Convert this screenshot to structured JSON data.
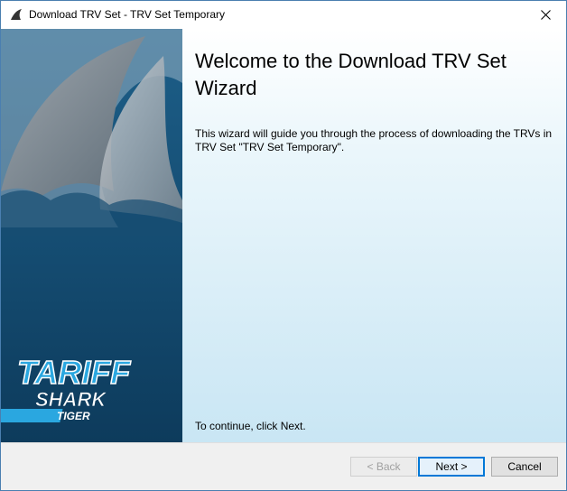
{
  "window": {
    "title": "Download TRV Set - TRV Set Temporary",
    "app_icon": "shark-fin-icon",
    "close_icon": "close-icon"
  },
  "banner": {
    "logo_lines": [
      "TARIFF",
      "SHARK",
      "TIGER"
    ]
  },
  "content": {
    "title": "Welcome to the Download TRV Set Wizard",
    "description": "This wizard will guide you through the process of downloading the TRVs in TRV Set \"TRV Set Temporary\".",
    "continue_text": "To continue, click Next."
  },
  "buttons": {
    "back_label": "< Back",
    "next_label": "Next >",
    "cancel_label": "Cancel"
  },
  "colors": {
    "banner_dark": "#0d3b5c",
    "banner_mid": "#1d5f89",
    "logo_blue": "#2aa7e0",
    "accent": "#0078d7"
  }
}
